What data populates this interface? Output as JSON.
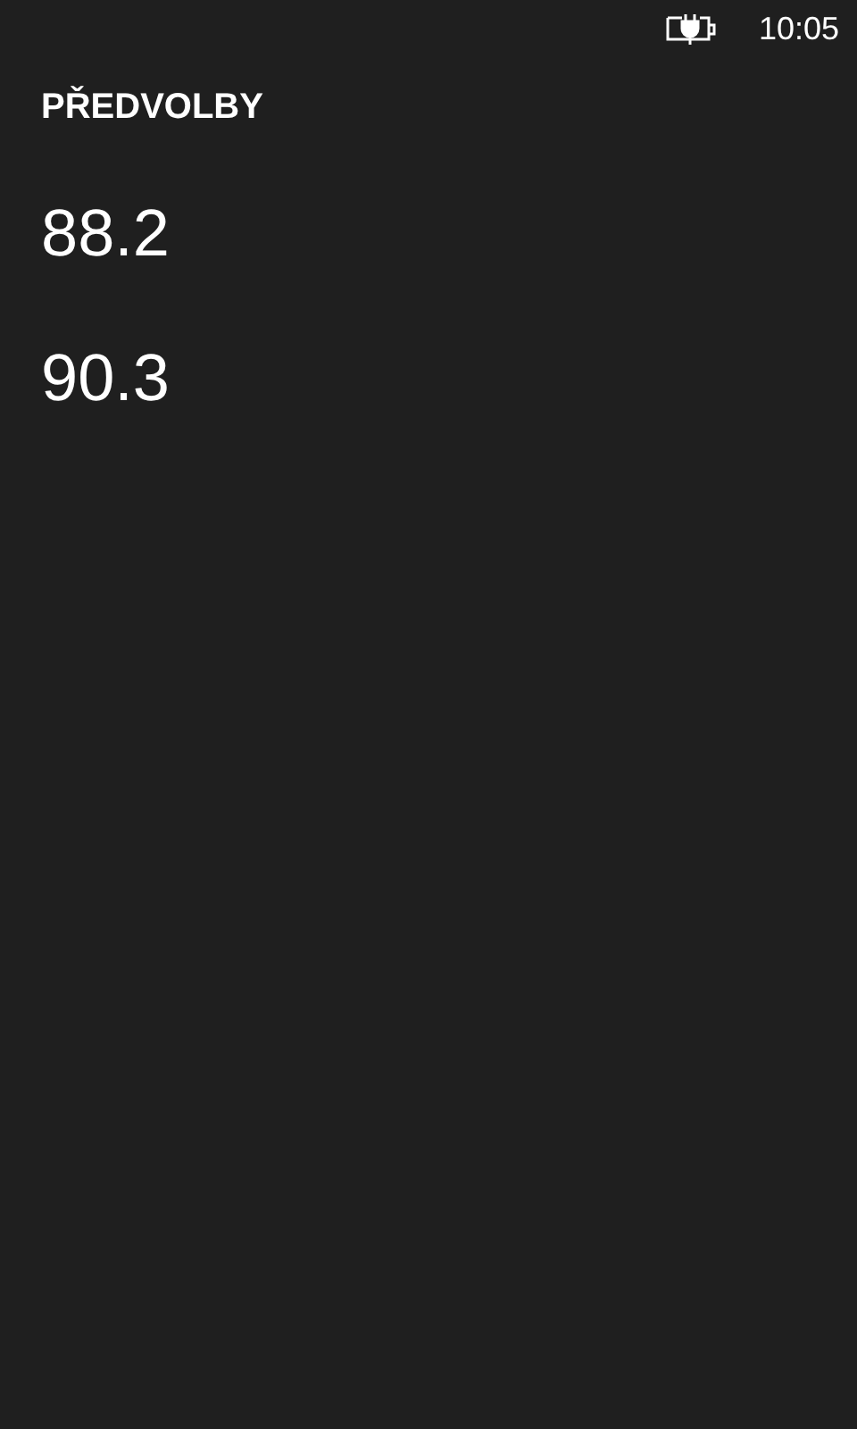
{
  "status_bar": {
    "time": "10:05"
  },
  "title": "PŘEDVOLBY",
  "presets": [
    {
      "frequency": "88.2"
    },
    {
      "frequency": "90.3"
    }
  ]
}
